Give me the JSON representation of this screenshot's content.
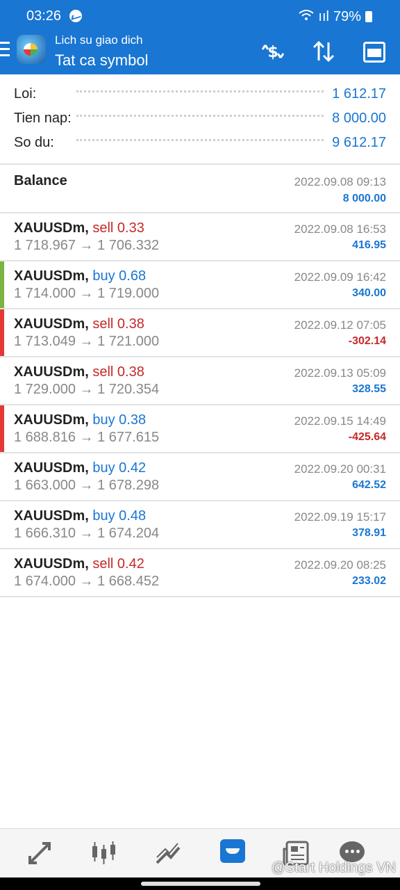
{
  "status_bar": {
    "time": "03:26",
    "signal": "ııl",
    "battery": "79%"
  },
  "header": {
    "subtitle": "Lich su giao dich",
    "title": "Tat ca symbol"
  },
  "summary": [
    {
      "label": "Loi:",
      "value": "1 612.17"
    },
    {
      "label": "Tien nap:",
      "value": "8 000.00"
    },
    {
      "label": "So du:",
      "value": "9 612.17"
    }
  ],
  "balance": {
    "label": "Balance",
    "date": "2022.09.08 09:13",
    "amount": "8 000.00"
  },
  "deals": [
    {
      "symbol": "XAUUSDm,",
      "side": "sell 0.33",
      "side_color": "#c62828",
      "prices": "1 718.967 → 1 706.332",
      "date": "2022.09.08 16:53",
      "profit": "416.95",
      "profit_color": "#1976d2",
      "marker": ""
    },
    {
      "symbol": "XAUUSDm,",
      "side": "buy 0.68",
      "side_color": "#1976d2",
      "prices": "1 714.000 → 1 719.000",
      "date": "2022.09.09 16:42",
      "profit": "340.00",
      "profit_color": "#1976d2",
      "marker": "#7cb342"
    },
    {
      "symbol": "XAUUSDm,",
      "side": "sell 0.38",
      "side_color": "#c62828",
      "prices": "1 713.049 → 1 721.000",
      "date": "2022.09.12 07:05",
      "profit": "-302.14",
      "profit_color": "#c62828",
      "marker": "#e53935"
    },
    {
      "symbol": "XAUUSDm,",
      "side": "sell 0.38",
      "side_color": "#c62828",
      "prices": "1 729.000 → 1 720.354",
      "date": "2022.09.13 05:09",
      "profit": "328.55",
      "profit_color": "#1976d2",
      "marker": ""
    },
    {
      "symbol": "XAUUSDm,",
      "side": "buy 0.38",
      "side_color": "#1976d2",
      "prices": "1 688.816 → 1 677.615",
      "date": "2022.09.15 14:49",
      "profit": "-425.64",
      "profit_color": "#c62828",
      "marker": "#e53935"
    },
    {
      "symbol": "XAUUSDm,",
      "side": "buy 0.42",
      "side_color": "#1976d2",
      "prices": "1 663.000 → 1 678.298",
      "date": "2022.09.20 00:31",
      "profit": "642.52",
      "profit_color": "#1976d2",
      "marker": ""
    },
    {
      "symbol": "XAUUSDm,",
      "side": "buy 0.48",
      "side_color": "#1976d2",
      "prices": "1 666.310 → 1 674.204",
      "date": "2022.09.19 15:17",
      "profit": "378.91",
      "profit_color": "#1976d2",
      "marker": ""
    },
    {
      "symbol": "XAUUSDm,",
      "side": "sell 0.42",
      "side_color": "#c62828",
      "prices": "1 674.000 → 1 668.452",
      "date": "2022.09.20 08:25",
      "profit": "233.02",
      "profit_color": "#1976d2",
      "marker": ""
    }
  ],
  "bottom_nav": [
    {
      "icon": "quotes-icon"
    },
    {
      "icon": "chart-icon"
    },
    {
      "icon": "trade-icon"
    },
    {
      "icon": "history-icon",
      "active": true
    },
    {
      "icon": "news-icon"
    },
    {
      "icon": "chat-icon"
    }
  ],
  "watermark": "@Start Holdings VN",
  "colors": {
    "accent": "#1976d2",
    "sell": "#c62828",
    "win_marker": "#7cb342",
    "loss_marker": "#e53935"
  }
}
